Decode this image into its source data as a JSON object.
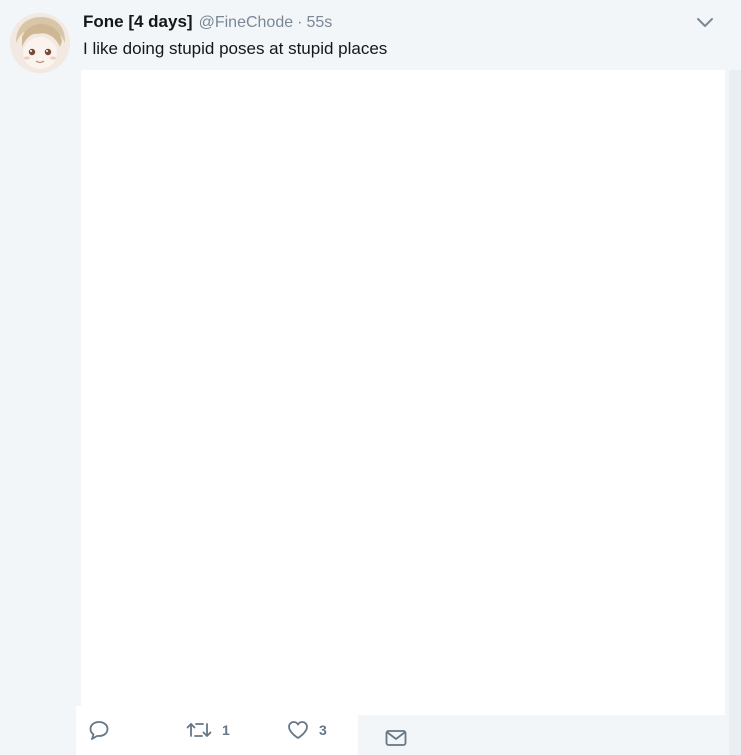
{
  "tweet": {
    "display_name": "Fone [4 days]",
    "handle": "@FineChode",
    "separator": "·",
    "timestamp": "55s",
    "text": "I like doing stupid poses at stupid places",
    "avatar_icon": "anime-avatar-icon",
    "menu_icon": "chevron-down-icon"
  },
  "actions": {
    "reply_icon": "reply-icon",
    "retweet_icon": "retweet-icon",
    "retweet_count": "1",
    "like_icon": "heart-icon",
    "like_count": "3",
    "dm_icon": "envelope-icon"
  },
  "colors": {
    "background": "#f3f6f9",
    "text": "#14171a",
    "muted": "#7a8896",
    "icon": "#657786"
  }
}
